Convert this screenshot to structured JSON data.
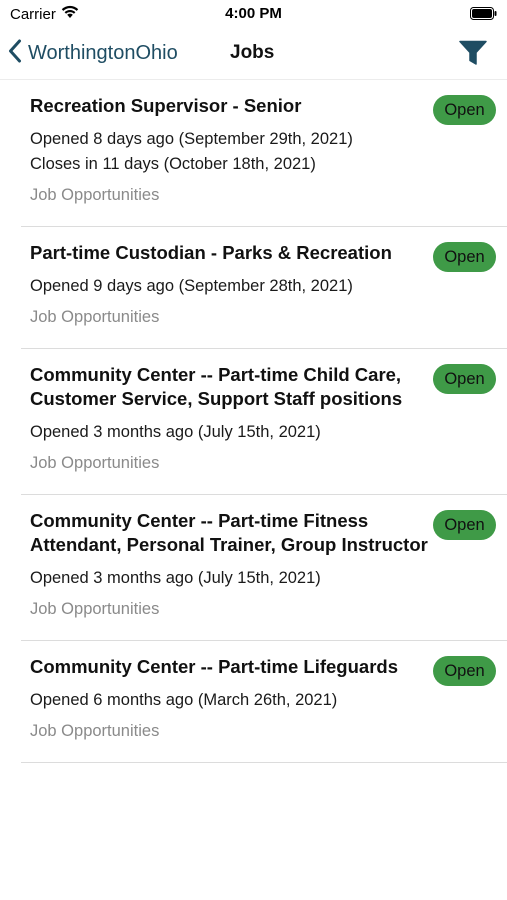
{
  "status_bar": {
    "carrier": "Carrier",
    "time": "4:00 PM"
  },
  "nav": {
    "back_label": "WorthingtonOhio",
    "title": "Jobs"
  },
  "colors": {
    "accent": "#1f4d63",
    "badge_green": "#3f9a47",
    "muted": "#8a8a8a"
  },
  "jobs": [
    {
      "title": "Recreation Supervisor - Senior",
      "opened": "Opened 8 days ago (September 29th, 2021)",
      "closes": "Closes in 11 days (October 18th, 2021)",
      "category": "Job Opportunities",
      "status": "Open"
    },
    {
      "title": "Part-time Custodian - Parks & Recreation",
      "opened": "Opened 9 days ago (September 28th, 2021)",
      "category": "Job Opportunities",
      "status": "Open"
    },
    {
      "title": "Community Center -- Part-time Child Care, Customer Service, Support Staff positions",
      "opened": "Opened 3 months ago (July 15th, 2021)",
      "category": "Job Opportunities",
      "status": "Open"
    },
    {
      "title": "Community Center -- Part-time Fitness Attendant, Personal Trainer, Group Instructor",
      "opened": "Opened 3 months ago (July 15th, 2021)",
      "category": "Job Opportunities",
      "status": "Open"
    },
    {
      "title": "Community Center -- Part-time Lifeguards",
      "opened": "Opened 6 months ago (March 26th, 2021)",
      "category": "Job Opportunities",
      "status": "Open"
    }
  ]
}
